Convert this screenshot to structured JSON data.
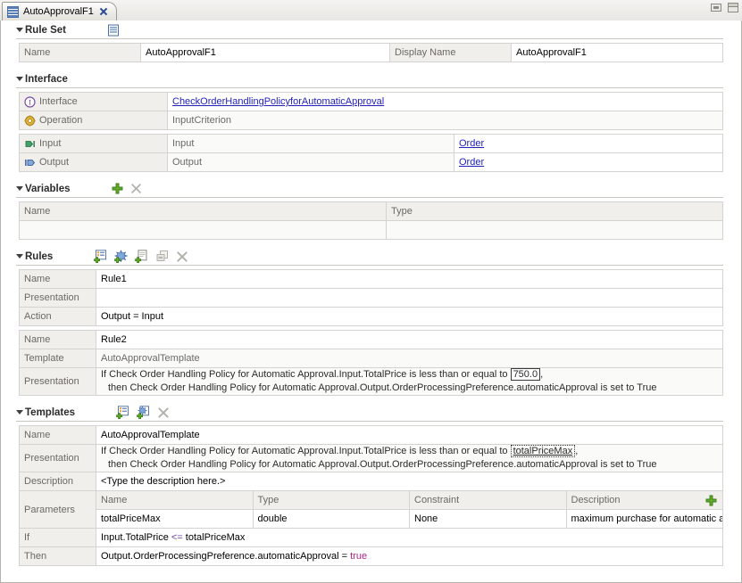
{
  "window": {
    "minimize_label": "Minimize",
    "maximize_label": "Maximize"
  },
  "tab": {
    "label": "AutoApprovalF1",
    "icon": "ruleset-icon",
    "close_icon": "close-icon"
  },
  "sections": {
    "ruleset": {
      "title": "Rule Set",
      "icon": "ruleset-properties-icon",
      "name_label": "Name",
      "name_value": "AutoApprovalF1",
      "display_name_label": "Display Name",
      "display_name_value": "AutoApprovalF1"
    },
    "interface": {
      "title": "Interface",
      "rows": [
        {
          "label": "Interface",
          "icon": "interface-icon",
          "value": "CheckOrderHandlingPolicyforAutomaticApproval",
          "is_link": true
        },
        {
          "label": "Operation",
          "icon": "operation-gear-icon",
          "value": "InputCriterion",
          "is_link": false
        }
      ],
      "params": [
        {
          "label": "Input",
          "icon": "input-arrow-icon",
          "name": "Input",
          "type": "Order"
        },
        {
          "label": "Output",
          "icon": "output-arrow-icon",
          "name": "Output",
          "type": "Order"
        }
      ]
    },
    "variables": {
      "title": "Variables",
      "add_icon": "add-variable-icon",
      "delete_icon": "delete-variable-icon",
      "columns": [
        "Name",
        "Type"
      ],
      "rows": []
    },
    "rules": {
      "title": "Rules",
      "tools": [
        "add-rule-icon",
        "add-template-rule-icon",
        "copy-rule-icon",
        "convert-rule-icon",
        "delete-rule-icon"
      ],
      "rule1": {
        "name_label": "Name",
        "name_value": "Rule1",
        "presentation_label": "Presentation",
        "presentation_value": "",
        "action_label": "Action",
        "action_value": "Output = Input"
      },
      "rule2": {
        "name_label": "Name",
        "name_value": "Rule2",
        "template_label": "Template",
        "template_value": "AutoApprovalTemplate",
        "presentation_label": "Presentation",
        "presentation_line1_pre": "If Check Order Handling Policy for Automatic Approval.Input.TotalPrice is less than or equal to ",
        "presentation_line1_boxed": "750.0",
        "presentation_line1_post": ",",
        "presentation_line2": "then Check Order Handling Policy for Automatic Approval.Output.OrderProcessingPreference.automaticApproval is set to True"
      }
    },
    "templates": {
      "title": "Templates",
      "tools": [
        "add-template-icon",
        "add-decision-table-template-icon",
        "delete-template-icon"
      ],
      "name_label": "Name",
      "name_value": "AutoApprovalTemplate",
      "presentation_label": "Presentation",
      "presentation_line1_pre": "If Check Order Handling Policy for Automatic Approval.Input.TotalPrice is less than or equal to ",
      "presentation_line1_boxed": "totalPriceMax",
      "presentation_line1_post": ",",
      "presentation_line2": "then Check Order Handling Policy for Automatic Approval.Output.OrderProcessingPreference.automaticApproval is set to True",
      "description_label": "Description",
      "description_value": "<Type the description here.>",
      "parameters_label": "Parameters",
      "parameters_add_icon": "add-parameter-icon",
      "parameters_columns": [
        "Name",
        "Type",
        "Constraint",
        "Description"
      ],
      "parameters_rows": [
        {
          "name": "totalPriceMax",
          "type": "double",
          "constraint": "None",
          "description": "maximum purchase for automatic approval"
        }
      ],
      "if_label": "If",
      "if_value": "Input.TotalPrice <= totalPriceMax",
      "if_value_lhs": "Input.TotalPrice ",
      "if_value_op": "<=",
      "if_value_rhs": " totalPriceMax",
      "then_label": "Then",
      "then_value_lhs": "Output.OrderProcessingPreference.automaticApproval = ",
      "then_value_kw": "true"
    }
  },
  "colors": {
    "link": "#2222bb",
    "label_text": "#6b6963",
    "operator": "#6a3fa0",
    "keyword": "#b1268a",
    "accent_green": "#4f9a20"
  }
}
